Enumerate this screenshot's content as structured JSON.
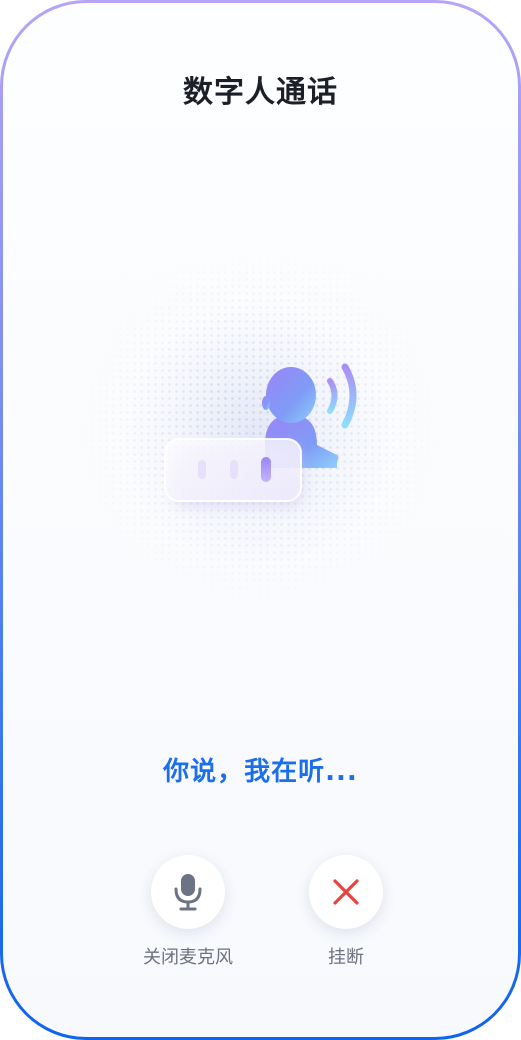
{
  "header": {
    "title": "数字人通话"
  },
  "status": {
    "text": "你说，我在听..."
  },
  "controls": {
    "mic": {
      "label": "关闭麦克风",
      "icon": "microphone-icon"
    },
    "hangup": {
      "label": "挂断",
      "icon": "close-icon"
    }
  },
  "colors": {
    "accent": "#1d6fe9",
    "hangup_icon": "#e9433f",
    "mic_icon": "#6b7384"
  }
}
